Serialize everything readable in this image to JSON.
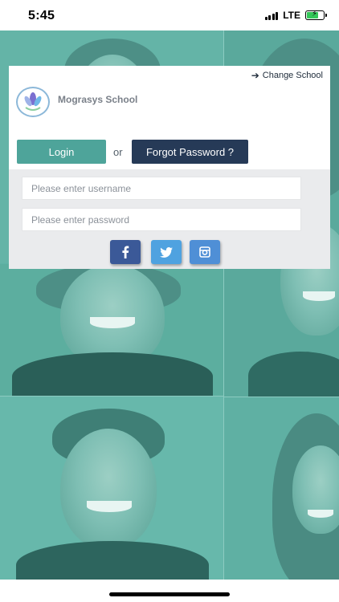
{
  "status_bar": {
    "time": "5:45",
    "network": "LTE",
    "battery_color": "#34c759"
  },
  "card": {
    "change_school_label": "Change School",
    "change_school_icon": "arrow-right-icon",
    "school_name": "Mograsys School",
    "login_button": "Login",
    "or_text": "or",
    "forgot_password_button": "Forgot Password ?",
    "username_placeholder": "Please enter username",
    "password_placeholder": "Please enter password",
    "social": [
      "facebook-icon",
      "twitter-icon",
      "instagram-icon"
    ]
  },
  "colors": {
    "login_button": "#4ea49a",
    "forgot_button": "#263a57",
    "facebook": "#3b5998",
    "twitter": "#4fa2e0",
    "instagram": "#4f8fd6",
    "background_overlay": "#5fb3a6"
  }
}
